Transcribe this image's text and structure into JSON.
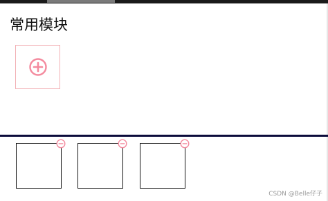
{
  "page": {
    "title": "常用模块",
    "watermark": "CSDN @Belle仔子"
  },
  "add_button": {
    "icon": "plus-circle-icon",
    "color": "#f48a9e",
    "border_color": "#f2b0b4"
  },
  "divider": {
    "color": "#0b0b3b"
  },
  "modules": {
    "count": 3,
    "tile_border_color": "#111111",
    "remove_icon": "minus-circle-icon",
    "remove_icon_color": "#f48a9e"
  }
}
